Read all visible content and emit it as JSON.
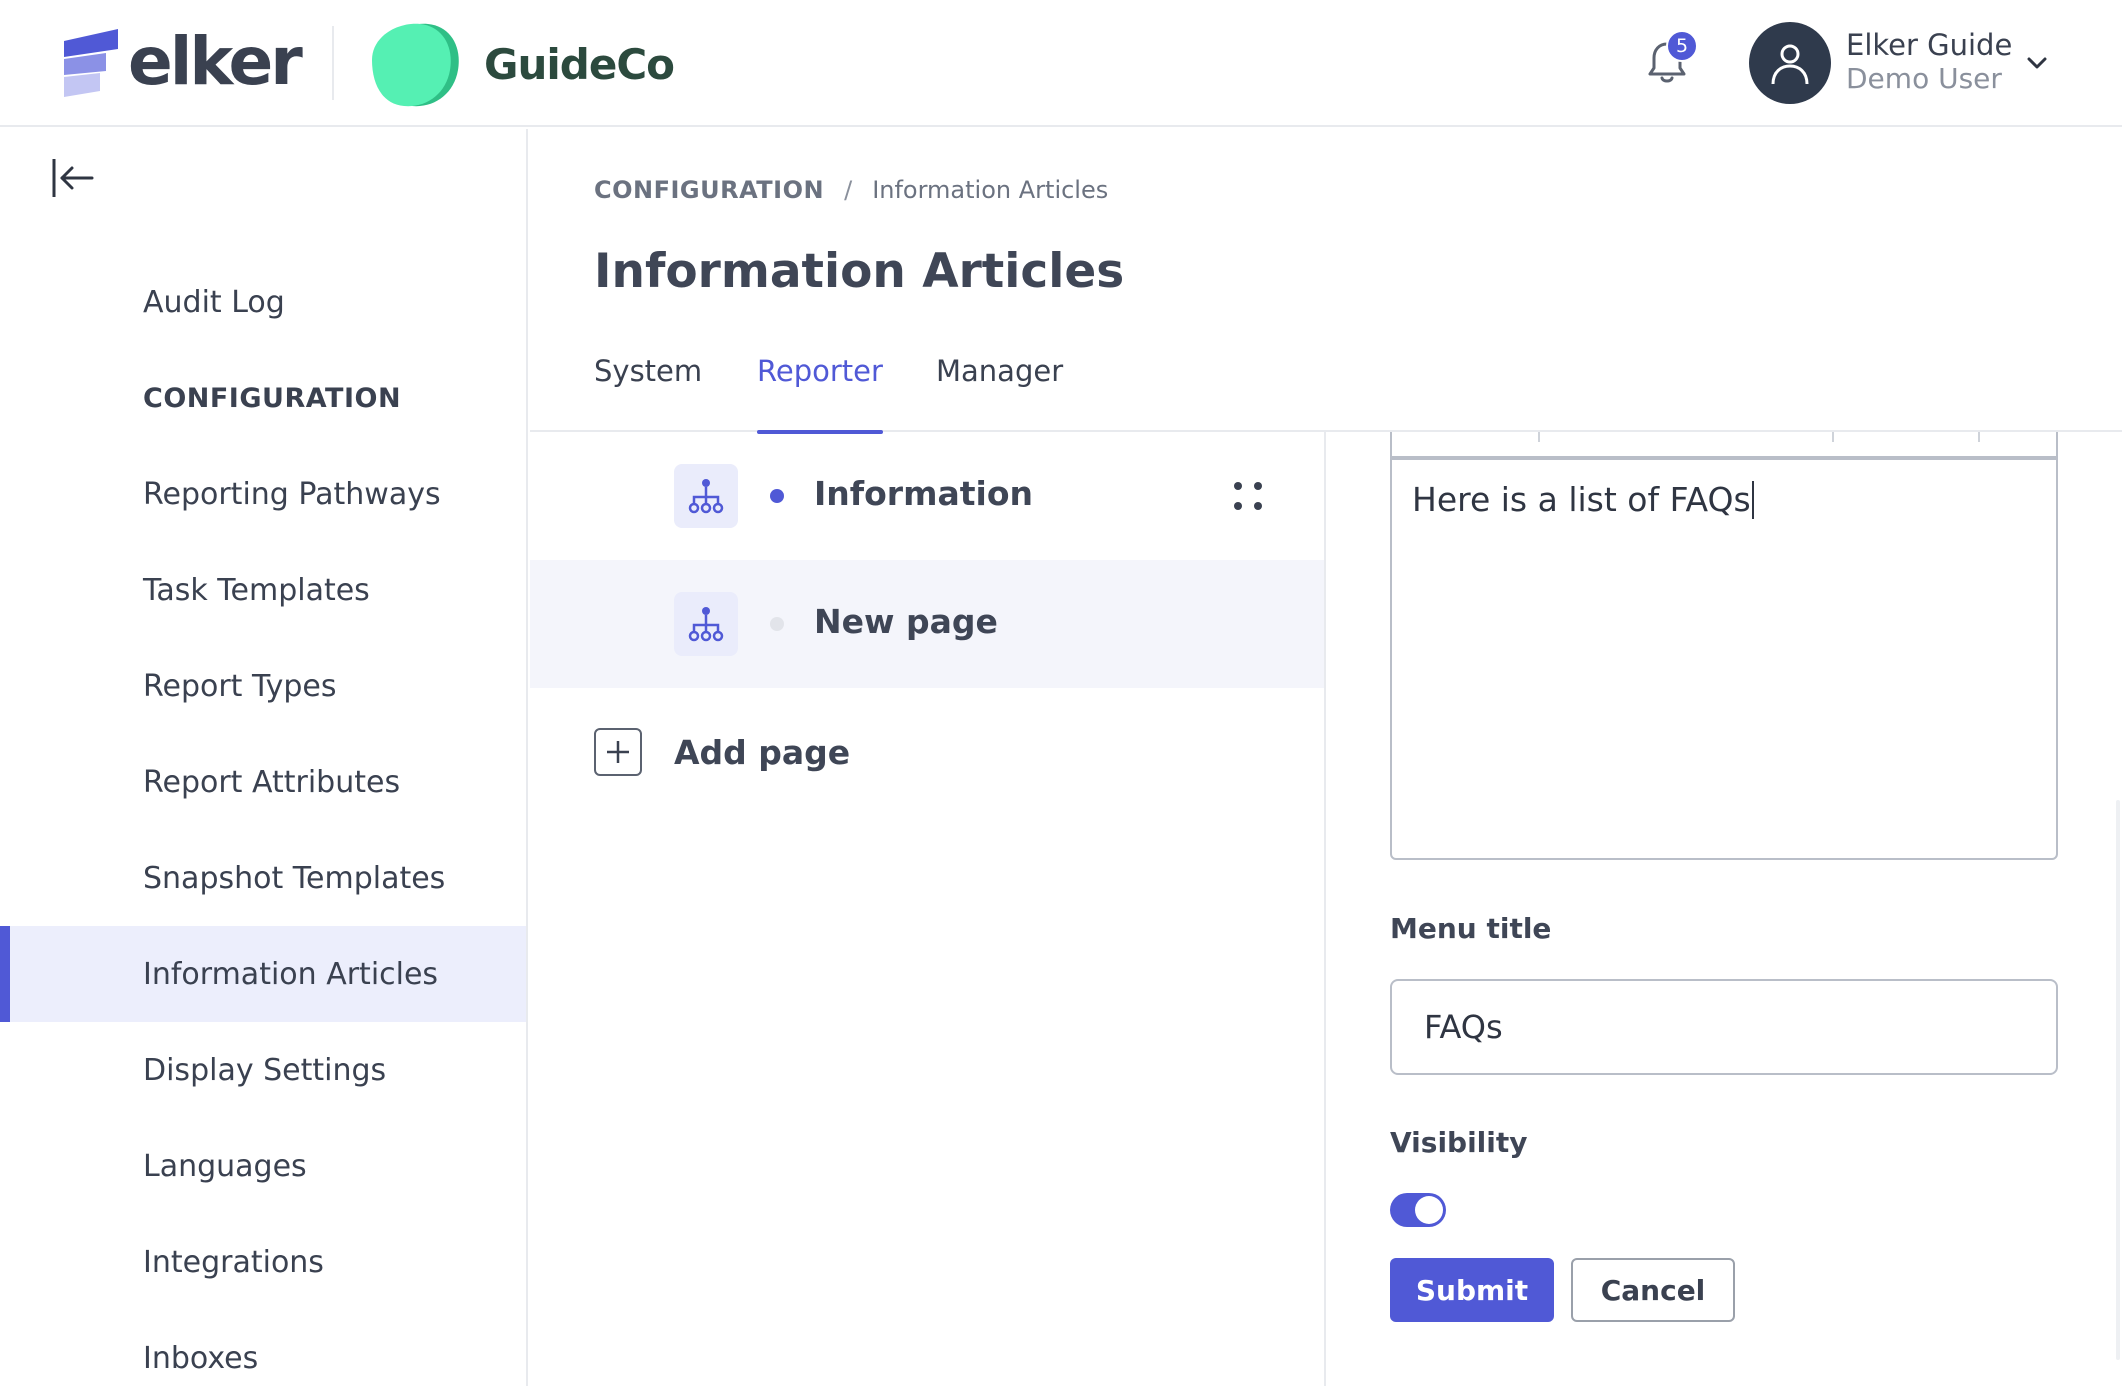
{
  "header": {
    "brand_name": "elker",
    "client_name": "GuideCo",
    "notifications_count": "5",
    "user_name": "Elker Guide",
    "user_role": "Demo User",
    "colors": {
      "accent": "#5059d6",
      "brand_green": "#3ee6a6"
    }
  },
  "sidebar": {
    "collapse_icon": "collapse-left-icon",
    "items": [
      {
        "label": "Audit Log",
        "type": "link"
      },
      {
        "label": "CONFIGURATION",
        "type": "section"
      },
      {
        "label": "Reporting Pathways",
        "type": "link"
      },
      {
        "label": "Task Templates",
        "type": "link"
      },
      {
        "label": "Report Types",
        "type": "link"
      },
      {
        "label": "Report Attributes",
        "type": "link"
      },
      {
        "label": "Snapshot Templates",
        "type": "link"
      },
      {
        "label": "Information Articles",
        "type": "link",
        "active": true
      },
      {
        "label": "Display Settings",
        "type": "link"
      },
      {
        "label": "Languages",
        "type": "link"
      },
      {
        "label": "Integrations",
        "type": "link"
      },
      {
        "label": "Inboxes",
        "type": "link"
      }
    ]
  },
  "breadcrumb": {
    "root": "CONFIGURATION",
    "separator": "/",
    "current": "Information Articles"
  },
  "main": {
    "title": "Information Articles",
    "tabs": [
      {
        "label": "System",
        "active": false
      },
      {
        "label": "Reporter",
        "active": true
      },
      {
        "label": "Manager",
        "active": false
      }
    ]
  },
  "pages": {
    "items": [
      {
        "label": "Information",
        "selected": false,
        "status": "active"
      },
      {
        "label": "New page",
        "selected": true,
        "status": "inactive"
      }
    ],
    "add_label": "Add page"
  },
  "editor": {
    "content": "Here is a list of FAQs",
    "menu_title_label": "Menu title",
    "menu_title_value": "FAQs",
    "visibility_label": "Visibility",
    "visibility_on": true,
    "submit_label": "Submit",
    "cancel_label": "Cancel"
  }
}
